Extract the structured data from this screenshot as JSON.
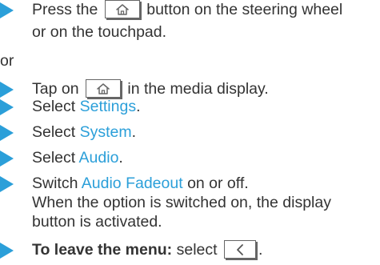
{
  "steps": {
    "step1": {
      "before": "Press the",
      "after": "button on the steering wheel",
      "line2": "or on the touchpad.",
      "key_icon": "home-icon"
    },
    "connector": "or",
    "step2": {
      "before": "Tap on",
      "after": "in the media display.",
      "key_icon": "home-icon"
    },
    "step3": {
      "before": "Select",
      "link": "Settings",
      "after": "."
    },
    "step4": {
      "before": "Select",
      "link": "System",
      "after": "."
    },
    "step5": {
      "before": "Select",
      "link": "Audio",
      "after": "."
    },
    "step6": {
      "before": "Switch",
      "link": "Audio Fadeout",
      "after": "on or off.",
      "line2": "When the option is switched on, the display",
      "line3": "button is activated."
    },
    "step7": {
      "bold": "To leave the menu:",
      "after": "select",
      "end": ".",
      "key_icon": "back-arrow-icon"
    }
  },
  "colors": {
    "accent": "#2b9fd9",
    "text": "#333333",
    "key_border": "#666666"
  }
}
